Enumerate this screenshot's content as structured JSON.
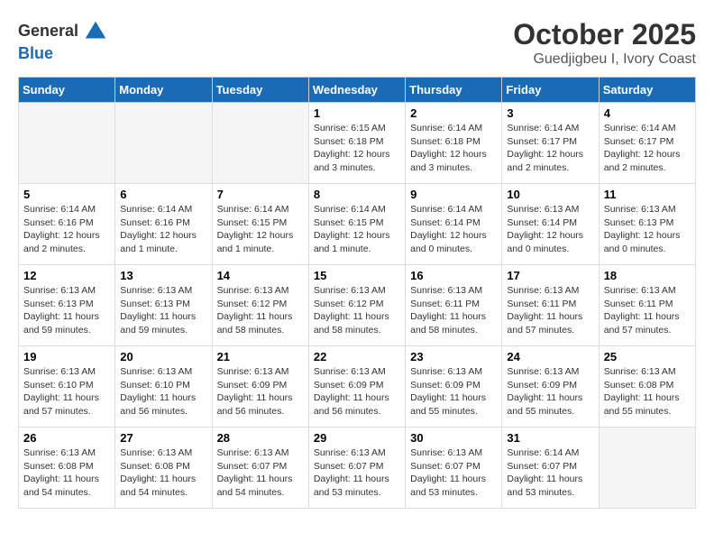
{
  "logo": {
    "general": "General",
    "blue": "Blue"
  },
  "header": {
    "month": "October 2025",
    "location": "Guedjigbeu I, Ivory Coast"
  },
  "weekdays": [
    "Sunday",
    "Monday",
    "Tuesday",
    "Wednesday",
    "Thursday",
    "Friday",
    "Saturday"
  ],
  "weeks": [
    [
      {
        "day": "",
        "info": ""
      },
      {
        "day": "",
        "info": ""
      },
      {
        "day": "",
        "info": ""
      },
      {
        "day": "1",
        "info": "Sunrise: 6:15 AM\nSunset: 6:18 PM\nDaylight: 12 hours\nand 3 minutes."
      },
      {
        "day": "2",
        "info": "Sunrise: 6:14 AM\nSunset: 6:18 PM\nDaylight: 12 hours\nand 3 minutes."
      },
      {
        "day": "3",
        "info": "Sunrise: 6:14 AM\nSunset: 6:17 PM\nDaylight: 12 hours\nand 2 minutes."
      },
      {
        "day": "4",
        "info": "Sunrise: 6:14 AM\nSunset: 6:17 PM\nDaylight: 12 hours\nand 2 minutes."
      }
    ],
    [
      {
        "day": "5",
        "info": "Sunrise: 6:14 AM\nSunset: 6:16 PM\nDaylight: 12 hours\nand 2 minutes."
      },
      {
        "day": "6",
        "info": "Sunrise: 6:14 AM\nSunset: 6:16 PM\nDaylight: 12 hours\nand 1 minute."
      },
      {
        "day": "7",
        "info": "Sunrise: 6:14 AM\nSunset: 6:15 PM\nDaylight: 12 hours\nand 1 minute."
      },
      {
        "day": "8",
        "info": "Sunrise: 6:14 AM\nSunset: 6:15 PM\nDaylight: 12 hours\nand 1 minute."
      },
      {
        "day": "9",
        "info": "Sunrise: 6:14 AM\nSunset: 6:14 PM\nDaylight: 12 hours\nand 0 minutes."
      },
      {
        "day": "10",
        "info": "Sunrise: 6:13 AM\nSunset: 6:14 PM\nDaylight: 12 hours\nand 0 minutes."
      },
      {
        "day": "11",
        "info": "Sunrise: 6:13 AM\nSunset: 6:13 PM\nDaylight: 12 hours\nand 0 minutes."
      }
    ],
    [
      {
        "day": "12",
        "info": "Sunrise: 6:13 AM\nSunset: 6:13 PM\nDaylight: 11 hours\nand 59 minutes."
      },
      {
        "day": "13",
        "info": "Sunrise: 6:13 AM\nSunset: 6:13 PM\nDaylight: 11 hours\nand 59 minutes."
      },
      {
        "day": "14",
        "info": "Sunrise: 6:13 AM\nSunset: 6:12 PM\nDaylight: 11 hours\nand 58 minutes."
      },
      {
        "day": "15",
        "info": "Sunrise: 6:13 AM\nSunset: 6:12 PM\nDaylight: 11 hours\nand 58 minutes."
      },
      {
        "day": "16",
        "info": "Sunrise: 6:13 AM\nSunset: 6:11 PM\nDaylight: 11 hours\nand 58 minutes."
      },
      {
        "day": "17",
        "info": "Sunrise: 6:13 AM\nSunset: 6:11 PM\nDaylight: 11 hours\nand 57 minutes."
      },
      {
        "day": "18",
        "info": "Sunrise: 6:13 AM\nSunset: 6:11 PM\nDaylight: 11 hours\nand 57 minutes."
      }
    ],
    [
      {
        "day": "19",
        "info": "Sunrise: 6:13 AM\nSunset: 6:10 PM\nDaylight: 11 hours\nand 57 minutes."
      },
      {
        "day": "20",
        "info": "Sunrise: 6:13 AM\nSunset: 6:10 PM\nDaylight: 11 hours\nand 56 minutes."
      },
      {
        "day": "21",
        "info": "Sunrise: 6:13 AM\nSunset: 6:09 PM\nDaylight: 11 hours\nand 56 minutes."
      },
      {
        "day": "22",
        "info": "Sunrise: 6:13 AM\nSunset: 6:09 PM\nDaylight: 11 hours\nand 56 minutes."
      },
      {
        "day": "23",
        "info": "Sunrise: 6:13 AM\nSunset: 6:09 PM\nDaylight: 11 hours\nand 55 minutes."
      },
      {
        "day": "24",
        "info": "Sunrise: 6:13 AM\nSunset: 6:09 PM\nDaylight: 11 hours\nand 55 minutes."
      },
      {
        "day": "25",
        "info": "Sunrise: 6:13 AM\nSunset: 6:08 PM\nDaylight: 11 hours\nand 55 minutes."
      }
    ],
    [
      {
        "day": "26",
        "info": "Sunrise: 6:13 AM\nSunset: 6:08 PM\nDaylight: 11 hours\nand 54 minutes."
      },
      {
        "day": "27",
        "info": "Sunrise: 6:13 AM\nSunset: 6:08 PM\nDaylight: 11 hours\nand 54 minutes."
      },
      {
        "day": "28",
        "info": "Sunrise: 6:13 AM\nSunset: 6:07 PM\nDaylight: 11 hours\nand 54 minutes."
      },
      {
        "day": "29",
        "info": "Sunrise: 6:13 AM\nSunset: 6:07 PM\nDaylight: 11 hours\nand 53 minutes."
      },
      {
        "day": "30",
        "info": "Sunrise: 6:13 AM\nSunset: 6:07 PM\nDaylight: 11 hours\nand 53 minutes."
      },
      {
        "day": "31",
        "info": "Sunrise: 6:14 AM\nSunset: 6:07 PM\nDaylight: 11 hours\nand 53 minutes."
      },
      {
        "day": "",
        "info": ""
      }
    ]
  ]
}
